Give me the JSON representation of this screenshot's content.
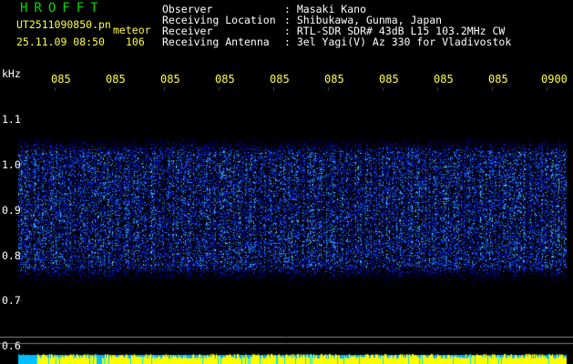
{
  "header": {
    "title": "HROFFT",
    "filename": "UT2511090850.pn",
    "event_type": "meteor",
    "datetime": "25.11.09 08:50",
    "count": "106",
    "fields": [
      {
        "label": "Observer",
        "value": ": Masaki Kano"
      },
      {
        "label": "Receiving Location",
        "value": ": Shibukawa, Gunma, Japan"
      },
      {
        "label": "Receiver",
        "value": ": RTL-SDR SDR# 43dB L15 103.2MHz CW"
      },
      {
        "label": "Receiving Antenna",
        "value": ": 3el Yagi(V) Az 330 for Vladivostok"
      }
    ]
  },
  "axes": {
    "y_unit": "kHz",
    "y_ticks": [
      "1.1",
      "1.0",
      "0.9",
      "0.8",
      "0.7",
      "0.6"
    ],
    "time_ticks": [
      "085",
      "085",
      "085",
      "085",
      "085",
      "085",
      "085",
      "085",
      "085",
      "0900"
    ]
  },
  "colors": {
    "title": "#00dd00",
    "text": "#ffffff",
    "time_ticks": "#ffff40",
    "signal_low": "#0000c0",
    "signal_high": "#00ffff",
    "bottom_bar": "#ffff00"
  }
}
